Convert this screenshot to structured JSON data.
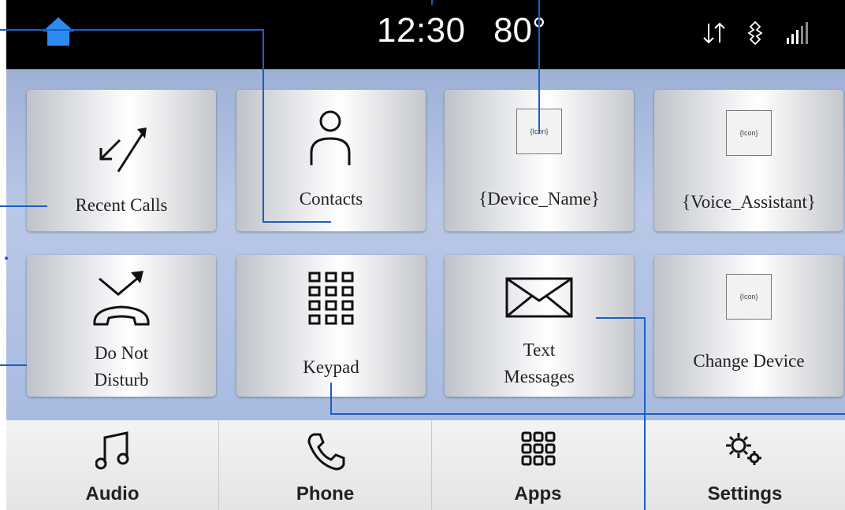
{
  "status": {
    "time": "12:30",
    "temperature": "80°",
    "icons": [
      "home-icon",
      "data-transfer-icon",
      "bluetooth-icon",
      "signal-strength-icon"
    ]
  },
  "tiles": {
    "recent_calls": "Recent Calls",
    "contacts": "Contacts",
    "device_name": "{Device_Name}",
    "voice_assistant": "{Voice_Assistant}",
    "dnd_line1": "Do Not",
    "dnd_line2": "Disturb",
    "keypad": "Keypad",
    "text_line1": "Text",
    "text_line2": "Messages",
    "change_device": "Change Device",
    "icon_placeholder": "{Icon}"
  },
  "nav": {
    "audio": "Audio",
    "phone": "Phone",
    "apps": "Apps",
    "settings": "Settings"
  },
  "colors": {
    "annotation_line": "#1a5fc4",
    "home_icon": "#2a8cf0"
  }
}
